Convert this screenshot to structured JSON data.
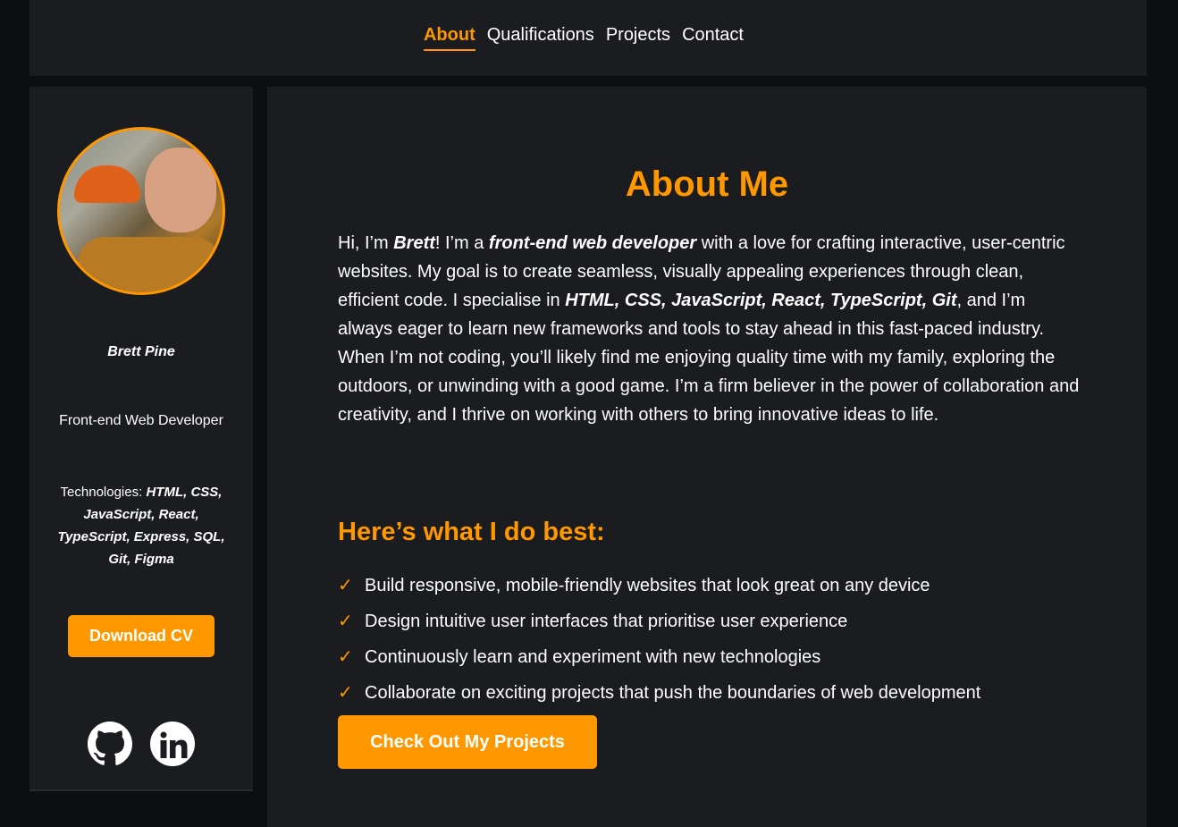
{
  "nav": {
    "items": [
      {
        "label": "About",
        "active": true
      },
      {
        "label": "Qualifications"
      },
      {
        "label": "Projects"
      },
      {
        "label": "Contact"
      }
    ]
  },
  "sidebar": {
    "name": "Brett Pine",
    "role": "Front-end Web Developer",
    "tech_label": "Technologies: ",
    "tech_list": "HTML, CSS, JavaScript, React, TypeScript, Express, SQL, Git, Figma",
    "cv_button": "Download CV",
    "icons": [
      "github-icon",
      "linkedin-icon"
    ]
  },
  "main": {
    "title": "About Me",
    "intro": {
      "p1": [
        "Hi, I’m ",
        "Brett",
        "! I’m a ",
        "front-end web developer",
        " with a love for crafting interactive, user-centric websites. My goal is to create seamless, visually appealing experiences through clean, efficient code. I specialise in ",
        "HTML, CSS, JavaScript, React, TypeScript, Git",
        ", and I’m always eager to learn new frameworks and tools to stay ahead in this fast-paced industry."
      ],
      "p2": "When I’m not coding, you’ll likely find me enjoying quality time with my family, exploring the outdoors, or unwinding with a good game. I’m a firm believer in the power of collaboration and creativity, and I thrive on working with others to bring innovative ideas to life."
    },
    "subtitle": "Here’s what I do best:",
    "check": "✓",
    "skills": [
      "Build responsive, mobile-friendly websites that look great on any device",
      "Design intuitive user interfaces that prioritise user experience",
      "Continuously learn and experiment with new technologies",
      "Collaborate on exciting projects that push the boundaries of web development"
    ],
    "projects_button": "Check Out My Projects"
  },
  "colors": {
    "accent": "#ff9800",
    "panel": "#1b1c1f",
    "background": "#0d0e10"
  }
}
